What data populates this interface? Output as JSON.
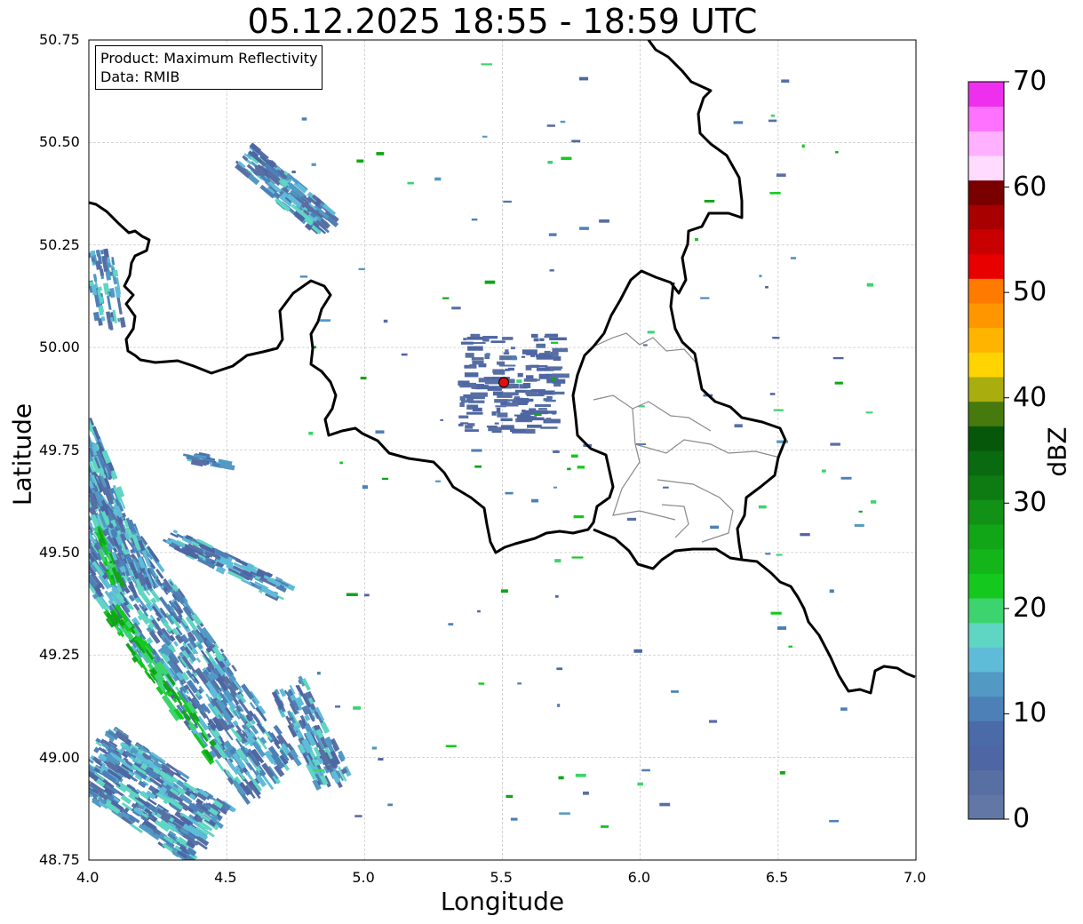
{
  "title": "05.12.2025 18:55 - 18:59 UTC",
  "info": {
    "product": "Product: Maximum Reflectivity",
    "data": "Data: RMIB"
  },
  "axes": {
    "xlabel": "Longitude",
    "ylabel": "Latitude",
    "xlim": [
      4.0,
      7.0
    ],
    "ylim": [
      48.75,
      50.75
    ],
    "xticks": [
      "4.0",
      "4.5",
      "5.0",
      "5.5",
      "6.0",
      "6.5",
      "7.0"
    ],
    "yticks": [
      "50.75",
      "50.50",
      "50.25",
      "50.00",
      "49.75",
      "49.50",
      "49.25",
      "49.00",
      "48.75"
    ]
  },
  "radar_site": {
    "lon": 5.505,
    "lat": 49.915
  },
  "colorbar": {
    "label": "dBZ",
    "ticks": [
      "70",
      "60",
      "50",
      "40",
      "30",
      "20",
      "10",
      "0"
    ],
    "range": [
      0,
      70
    ],
    "colors": [
      "#6377a6",
      "#586fa4",
      "#4e66a3",
      "#4a6aa8",
      "#4d80b7",
      "#5299c4",
      "#5fbcd8",
      "#5fd5c3",
      "#3dd36f",
      "#14c81e",
      "#13b51b",
      "#11a518",
      "#119115",
      "#0e7a12",
      "#0a6a10",
      "#06570a",
      "#477a0c",
      "#a9ad0e",
      "#ffd400",
      "#ffb400",
      "#ff9600",
      "#ff7a00",
      "#e80000",
      "#c80000",
      "#a80000",
      "#7a0000",
      "#ffdcff",
      "#ffb0ff",
      "#ff72ff",
      "#ee30ee"
    ]
  }
}
